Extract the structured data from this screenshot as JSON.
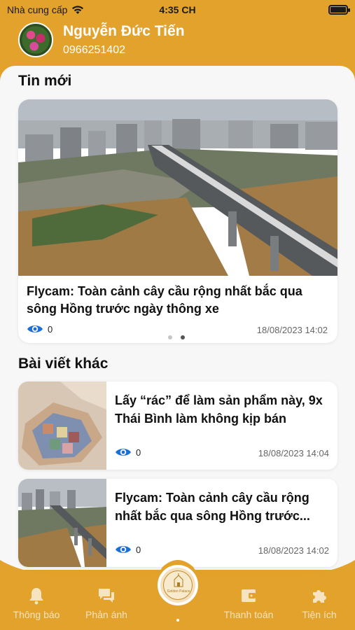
{
  "status_bar": {
    "carrier": "Nhà cung cấp",
    "time": "4:35 CH"
  },
  "user": {
    "name": "Nguyễn Đức Tiến",
    "phone": "0966251402"
  },
  "sections": {
    "latest": "Tin mới",
    "other": "Bài viết khác"
  },
  "featured": {
    "title": "Flycam: Toàn cảnh cây cầu rộng nhất bắc qua sông Hồng trước ngày thông xe",
    "views": "0",
    "date": "18/08/2023 14:02"
  },
  "carousel": {
    "pages": 2,
    "active_page": 2
  },
  "articles": [
    {
      "title": "Lấy “rác” để làm sản phẩm này, 9x Thái Bình làm không kịp bán",
      "views": "0",
      "date": "18/08/2023 14:04"
    },
    {
      "title": "Flycam: Toàn cảnh cây cầu rộng nhất bắc qua sông Hồng trước...",
      "views": "0",
      "date": "18/08/2023 14:02"
    }
  ],
  "tabs": [
    {
      "label": "Thông báo",
      "icon": "bell-icon"
    },
    {
      "label": "Phản ánh",
      "icon": "chat-icon"
    },
    {
      "label": "Golden Palace",
      "icon": "home-logo-icon"
    },
    {
      "label": "Thanh toán",
      "icon": "wallet-icon"
    },
    {
      "label": "Tiện ích",
      "icon": "puzzle-icon"
    }
  ],
  "colors": {
    "accent": "#e2a22b",
    "background": "#f7f7f8",
    "eye": "#1d6fd8"
  }
}
